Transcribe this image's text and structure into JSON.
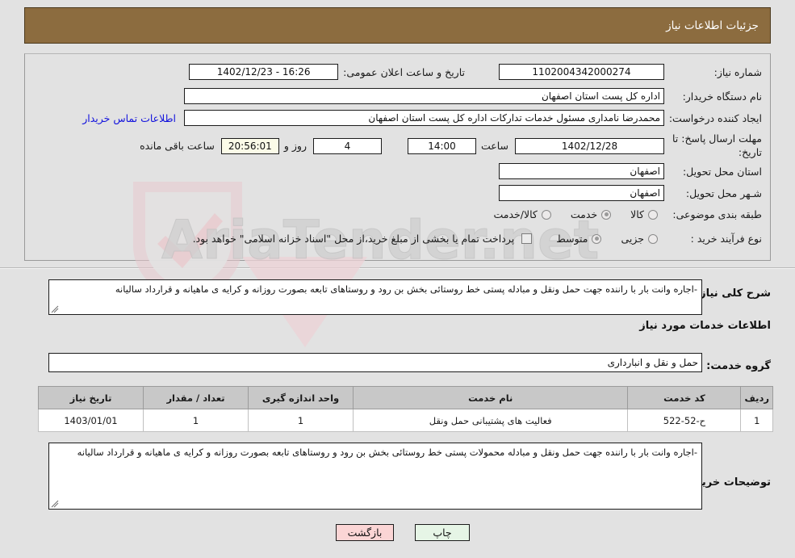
{
  "header": {
    "title": "جزئیات اطلاعات نیاز"
  },
  "colors": {
    "header_bar": "#8c6c3f",
    "page_bg": "#e2e2e2",
    "link": "#1111dd",
    "table_header": "#c8c8c8",
    "print_button": "#e6f5e6",
    "back_button": "#fbd5d5",
    "timer_field": "#fbfbe8"
  },
  "form": {
    "need_number_label": "شماره نیاز:",
    "need_number_value": "1102004342000274",
    "announce_datetime_label": "تاریخ و ساعت اعلان عمومی:",
    "announce_datetime_value": "16:26 - 1402/12/23",
    "buyer_org_label": "نام دستگاه خریدار:",
    "buyer_org_value": "اداره کل پست استان اصفهان",
    "requester_label": "ایجاد کننده درخواست:",
    "requester_value": "محمدرضا نامداری مسئول خدمات تدارکات اداره کل پست استان اصفهان",
    "buyer_contact_link": "اطلاعات تماس خریدار",
    "deadline_label": "مهلت ارسال پاسخ: تا تاریخ:",
    "deadline_date": "1402/12/28",
    "deadline_hour_label": "ساعت",
    "deadline_hour_value": "14:00",
    "remaining_days_value": "4",
    "remaining_days_label": "روز و",
    "remaining_time_value": "20:56:01",
    "remaining_time_label": "ساعت باقی مانده",
    "province_label": "استان محل تحویل:",
    "province_value": "اصفهان",
    "city_label": "شـهر محل تحویل:",
    "city_value": "اصفهان",
    "category_label": "طبقه بندی موضوعی:",
    "category_options": [
      {
        "label": "کالا",
        "selected": false
      },
      {
        "label": "خدمت",
        "selected": true
      },
      {
        "label": "کالا/خدمت",
        "selected": false
      }
    ],
    "process_label": "نوع فرآیند خرید :",
    "process_options": [
      {
        "label": "جزیی",
        "selected": false
      },
      {
        "label": "متوسط",
        "selected": true
      }
    ],
    "islamic_treasury_checkbox": {
      "checked": false,
      "label": "پرداخت تمام یا بخشی از مبلغ خرید،از محل \"اسناد خزانه اسلامی\" خواهد بود."
    }
  },
  "description": {
    "label": "شرح کلی نیاز:",
    "value": "-اجاره وانت بار با راننده جهت حمل ونقل و مبادله پستی خط روستائی بخش بن رود و روستاهای تابعه بصورت روزانه و کرایه ی ماهیانه و قرارداد سالیانه"
  },
  "services_section": {
    "heading": "اطلاعات خدمات مورد نیاز",
    "service_group_label": "گروه خدمت:",
    "service_group_value": "حمل و نقل و انبارداری"
  },
  "table": {
    "headers": [
      "ردیف",
      "کد خدمت",
      "نام خدمت",
      "واحد اندازه گیری",
      "تعداد / مقدار",
      "تاریخ نیاز"
    ],
    "rows": [
      {
        "row_no": "1",
        "service_code": "ح-52-522",
        "service_name": "فعالیت های پشتیبانی حمل ونقل",
        "unit": "1",
        "quantity": "1",
        "need_date": "1403/01/01"
      }
    ]
  },
  "buyer_notes": {
    "label": "توضیحات خریدار:",
    "value": "-اجاره وانت بار با راننده جهت حمل ونقل و مبادله محمولات  پستی خط روستائی بخش بن رود و روستاهای تابعه بصورت روزانه و کرایه ی ماهیانه و قرارداد سالیانه"
  },
  "actions": {
    "print_label": "چاپ",
    "back_label": "بازگشت"
  },
  "watermark": {
    "text": "AriaTender.net"
  }
}
